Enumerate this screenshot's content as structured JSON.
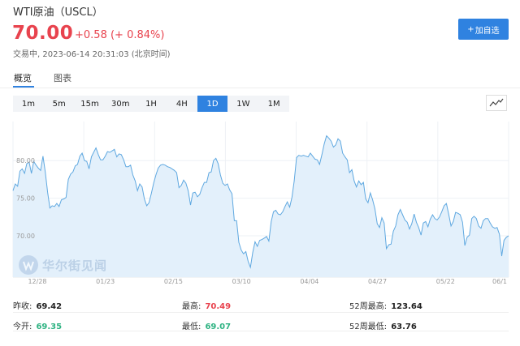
{
  "header": {
    "title": "WTI原油（USCL）",
    "price": "70.00",
    "change": "+0.58 (+ 0.84%)",
    "status": "交易中, 2023-06-14 20:31:03 (北京时间)",
    "add_button": "加自选"
  },
  "tabs": [
    {
      "label": "概览",
      "active": true
    },
    {
      "label": "图表",
      "active": false
    }
  ],
  "intervals": [
    {
      "label": "1m",
      "active": false
    },
    {
      "label": "5m",
      "active": false
    },
    {
      "label": "15m",
      "active": false
    },
    {
      "label": "30m",
      "active": false
    },
    {
      "label": "1H",
      "active": false
    },
    {
      "label": "4H",
      "active": false
    },
    {
      "label": "1D",
      "active": true
    },
    {
      "label": "1W",
      "active": false
    },
    {
      "label": "1M",
      "active": false
    }
  ],
  "chart_type_icon": "line-chart-icon",
  "watermark": "华尔街见闻",
  "colors": {
    "up": "#e8434e",
    "down": "#2fb383",
    "accent": "#2f82e0",
    "line": "#5fa8e0",
    "fill": "#e3f0fb"
  },
  "chart_data": {
    "type": "area",
    "x_ticks": [
      "12/28",
      "01/23",
      "02/15",
      "03/10",
      "04/04",
      "04/27",
      "05/22",
      "06/1"
    ],
    "y_ticks": [
      "80.00",
      "75.00",
      "70.00"
    ],
    "ylim": [
      64.5,
      85.2
    ],
    "values": [
      76.0,
      76.9,
      76.6,
      78.6,
      78.9,
      78.3,
      79.6,
      79.8,
      78.3,
      79.9,
      79.4,
      79.0,
      78.7,
      80.6,
      78.5,
      75.8,
      73.7,
      74.0,
      73.9,
      74.3,
      73.9,
      74.8,
      74.9,
      75.1,
      77.5,
      78.2,
      78.5,
      79.3,
      79.5,
      80.6,
      81.0,
      80.0,
      79.9,
      78.9,
      80.5,
      81.1,
      81.7,
      80.8,
      80.1,
      80.1,
      80.6,
      81.2,
      81.1,
      81.3,
      81.5,
      80.5,
      80.9,
      80.8,
      80.1,
      79.2,
      79.2,
      79.4,
      78.1,
      77.3,
      76.0,
      76.9,
      76.5,
      74.9,
      74.0,
      74.4,
      75.6,
      77.0,
      78.1,
      79.0,
      79.4,
      79.5,
      79.4,
      79.2,
      79.1,
      78.9,
      78.7,
      78.4,
      76.4,
      76.7,
      77.4,
      77.0,
      76.0,
      74.1,
      75.7,
      75.8,
      75.2,
      75.5,
      76.4,
      77.1,
      77.1,
      78.4,
      78.5,
      80.0,
      80.3,
      79.6,
      78.1,
      77.0,
      76.7,
      76.9,
      76.1,
      75.6,
      72.0,
      72.0,
      69.1,
      68.1,
      67.6,
      67.9,
      66.6,
      65.8,
      67.8,
      69.2,
      68.6,
      69.4,
      69.5,
      69.7,
      69.9,
      69.3,
      71.9,
      73.2,
      73.4,
      72.9,
      72.8,
      73.2,
      73.9,
      74.5,
      73.8,
      75.1,
      77.3,
      80.4,
      80.7,
      80.6,
      80.7,
      80.6,
      80.5,
      81.0,
      80.6,
      80.2,
      80.1,
      79.5,
      80.8,
      82.2,
      83.3,
      83.0,
      82.6,
      81.8,
      82.1,
      82.9,
      82.6,
      81.0,
      80.5,
      80.1,
      78.4,
      78.8,
      77.3,
      76.5,
      77.3,
      76.8,
      77.1,
      74.9,
      74.4,
      75.7,
      74.8,
      73.6,
      71.6,
      71.1,
      72.4,
      71.7,
      68.3,
      68.8,
      68.9,
      70.6,
      71.3,
      72.8,
      73.5,
      72.8,
      72.1,
      71.8,
      70.9,
      71.6,
      72.9,
      71.8,
      71.1,
      70.1,
      71.7,
      71.9,
      71.2,
      72.2,
      72.8,
      72.3,
      72.1,
      72.5,
      73.2,
      74.0,
      74.3,
      72.9,
      71.3,
      71.9,
      73.1,
      73.0,
      72.8,
      71.8,
      68.7,
      69.8,
      70.1,
      72.3,
      72.6,
      72.3,
      71.3,
      71.0,
      72.0,
      72.3,
      72.3,
      71.7,
      71.2,
      71.0,
      71.1,
      70.2,
      67.3,
      69.4,
      69.8,
      70.0
    ]
  },
  "stats": {
    "prev_close_label": "昨收:",
    "prev_close": "69.42",
    "high_label": "最高:",
    "high": "70.49",
    "wk52_high_label": "52周最高:",
    "wk52_high": "123.64",
    "open_label": "今开:",
    "open": "69.35",
    "low_label": "最低:",
    "low": "69.07",
    "wk52_low_label": "52周最低:",
    "wk52_low": "63.76"
  }
}
